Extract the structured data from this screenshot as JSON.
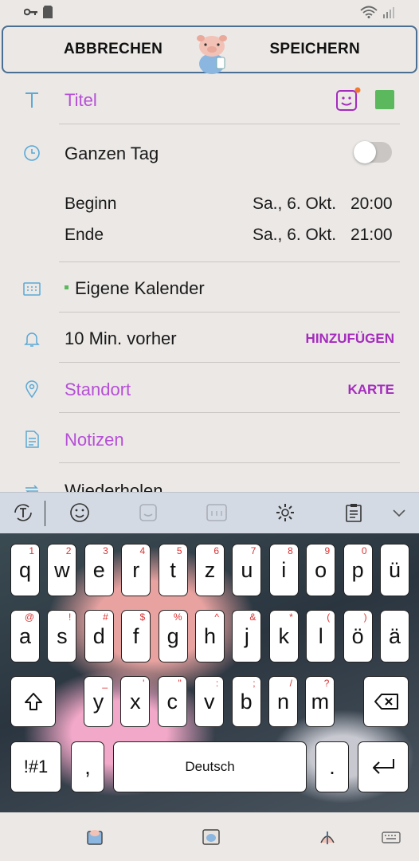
{
  "topbar": {
    "cancel": "ABBRECHEN",
    "save": "SPEICHERN"
  },
  "form": {
    "title_placeholder": "Titel",
    "allday_label": "Ganzen Tag",
    "allday_on": false,
    "start_label": "Beginn",
    "start_date": "Sa., 6. Okt.",
    "start_time": "20:00",
    "end_label": "Ende",
    "end_date": "Sa., 6. Okt.",
    "end_time": "21:00",
    "calendar_label": "Eigene Kalender",
    "calendar_color": "#5cb85c",
    "reminder_label": "10 Min. vorher",
    "reminder_action": "HINZUFÜGEN",
    "location_placeholder": "Standort",
    "location_action": "KARTE",
    "notes_placeholder": "Notizen",
    "repeat_label": "Wiederholen",
    "event_color": "#5cb85c"
  },
  "keyboard": {
    "row1": [
      {
        "k": "q",
        "h": "1"
      },
      {
        "k": "w",
        "h": "2"
      },
      {
        "k": "e",
        "h": "3"
      },
      {
        "k": "r",
        "h": "4"
      },
      {
        "k": "t",
        "h": "5"
      },
      {
        "k": "z",
        "h": "6"
      },
      {
        "k": "u",
        "h": "7"
      },
      {
        "k": "i",
        "h": "8"
      },
      {
        "k": "o",
        "h": "9"
      },
      {
        "k": "p",
        "h": "0"
      },
      {
        "k": "ü",
        "h": ""
      }
    ],
    "row2": [
      {
        "k": "a",
        "h": "@"
      },
      {
        "k": "s",
        "h": "!"
      },
      {
        "k": "d",
        "h": "#"
      },
      {
        "k": "f",
        "h": "$"
      },
      {
        "k": "g",
        "h": "%"
      },
      {
        "k": "h",
        "h": "^"
      },
      {
        "k": "j",
        "h": "&"
      },
      {
        "k": "k",
        "h": "*"
      },
      {
        "k": "l",
        "h": "("
      },
      {
        "k": "ö",
        "h": ")"
      },
      {
        "k": "ä",
        "h": ""
      }
    ],
    "row3": [
      {
        "k": "y",
        "h": "_"
      },
      {
        "k": "x",
        "h": "'"
      },
      {
        "k": "c",
        "h": "\""
      },
      {
        "k": "v",
        "h": ":"
      },
      {
        "k": "b",
        "h": ";"
      },
      {
        "k": "n",
        "h": "/"
      },
      {
        "k": "m",
        "h": "?"
      }
    ],
    "symbols_key": "!#1",
    "comma_key": ",",
    "space_label": "Deutsch",
    "period_key": "."
  },
  "colors": {
    "accent": "#a52bbd",
    "placeholder": "#b64fd6",
    "icon": "#5aa9d6",
    "frame": "#4a6f93"
  }
}
